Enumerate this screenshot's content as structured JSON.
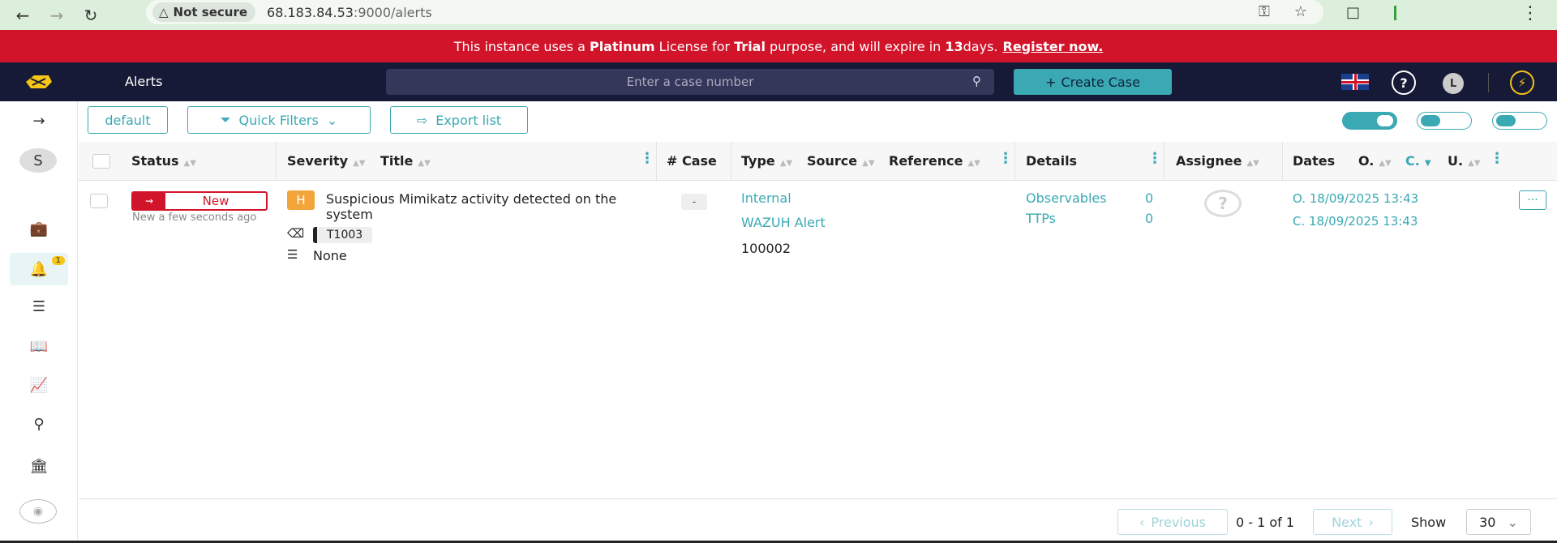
{
  "browser": {
    "not_secure": "Not secure",
    "url_host": "68.183.84.53",
    "url_path": ":9000/alerts"
  },
  "banner": {
    "prefix": "This instance uses a ",
    "license": "Platinum",
    "middle": " License for ",
    "purpose": "Trial",
    "middle2": " purpose, and will expire in ",
    "days": "13",
    "suffix": " days.",
    "register": "Register now."
  },
  "nav": {
    "title": "Alerts",
    "search_placeholder": "Enter a case number",
    "create_case": "Create Case",
    "help": "?",
    "avatar": "L"
  },
  "sidebar": {
    "user_initial": "S",
    "alerts_badge": "1"
  },
  "toolbar": {
    "default": "default",
    "quick_filters": "Quick Filters",
    "export_list": "Export list"
  },
  "table": {
    "headers": {
      "status": "Status",
      "severity": "Severity",
      "title": "Title",
      "case": "# Case",
      "type": "Type",
      "source": "Source",
      "reference": "Reference",
      "details": "Details",
      "assignee": "Assignee",
      "dates": "Dates",
      "o": "O.",
      "c": "C.",
      "u": "U."
    },
    "rows": [
      {
        "status": "New",
        "status_time": "New a few seconds ago",
        "severity": "H",
        "title": "Suspicious Mimikatz activity detected on the system",
        "tag": "T1003",
        "custom_fields": "None",
        "case": "-",
        "type": "Internal",
        "source": "WAZUH Alert",
        "reference": "100002",
        "observables_label": "Observables",
        "observables_count": "0",
        "ttps_label": "TTPs",
        "ttps_count": "0",
        "date_o": "O. 18/09/2025 13:43",
        "date_c": "C. 18/09/2025 13:43",
        "more": "···"
      }
    ]
  },
  "pagination": {
    "previous": "Previous",
    "range": "0 - 1 of 1",
    "next": "Next",
    "show_label": "Show",
    "show_value": "30"
  },
  "colors": {
    "accent": "#3aa9b4",
    "banner": "#d2142a",
    "nav": "#161a36",
    "severity_high": "#f3a43a"
  }
}
